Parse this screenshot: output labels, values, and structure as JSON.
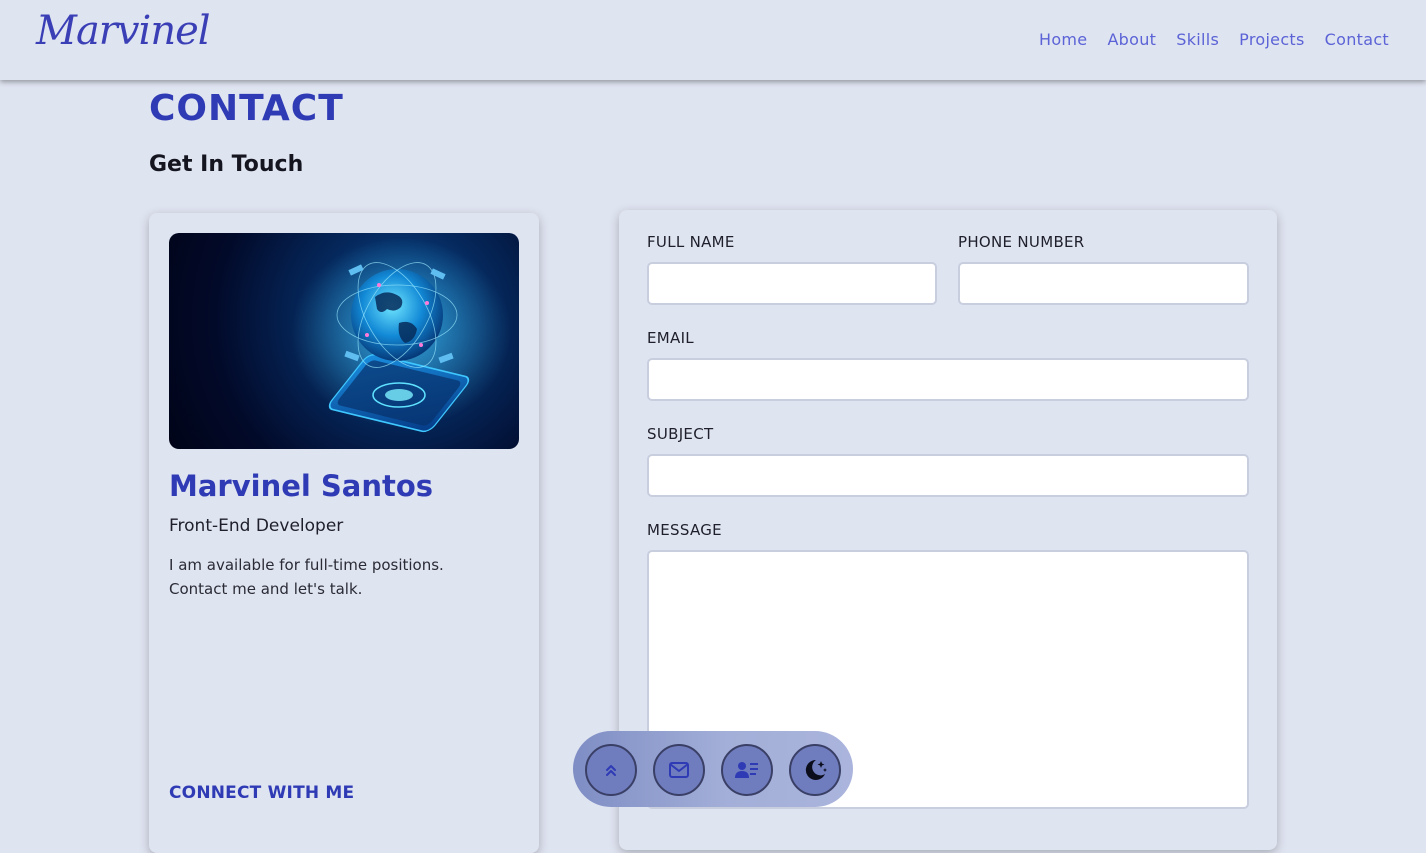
{
  "header": {
    "logo": "Marvinel",
    "nav": [
      "Home",
      "About",
      "Skills",
      "Projects",
      "Contact"
    ]
  },
  "section": {
    "title": "CONTACT",
    "subtitle": "Get In Touch"
  },
  "profile": {
    "image_icon": "globe-phone-illustration-icon",
    "name": "Marvinel Santos",
    "role": "Front-End Developer",
    "description": "I am available for full-time positions. Contact me and let's talk.",
    "connect_label": "CONNECT WITH ME"
  },
  "form": {
    "full_name": {
      "label": "FULL NAME",
      "value": ""
    },
    "phone": {
      "label": "PHONE NUMBER",
      "value": ""
    },
    "email": {
      "label": "EMAIL",
      "value": ""
    },
    "subject": {
      "label": "SUBJECT",
      "value": ""
    },
    "message": {
      "label": "MESSAGE",
      "value": ""
    }
  },
  "dock": {
    "buttons": [
      "chevrons-up-icon",
      "mail-icon",
      "contact-card-icon",
      "moon-stars-icon"
    ]
  },
  "colors": {
    "accent": "#2f3bb5",
    "background": "#dfe4f1",
    "nav_link": "#5b63d6"
  }
}
